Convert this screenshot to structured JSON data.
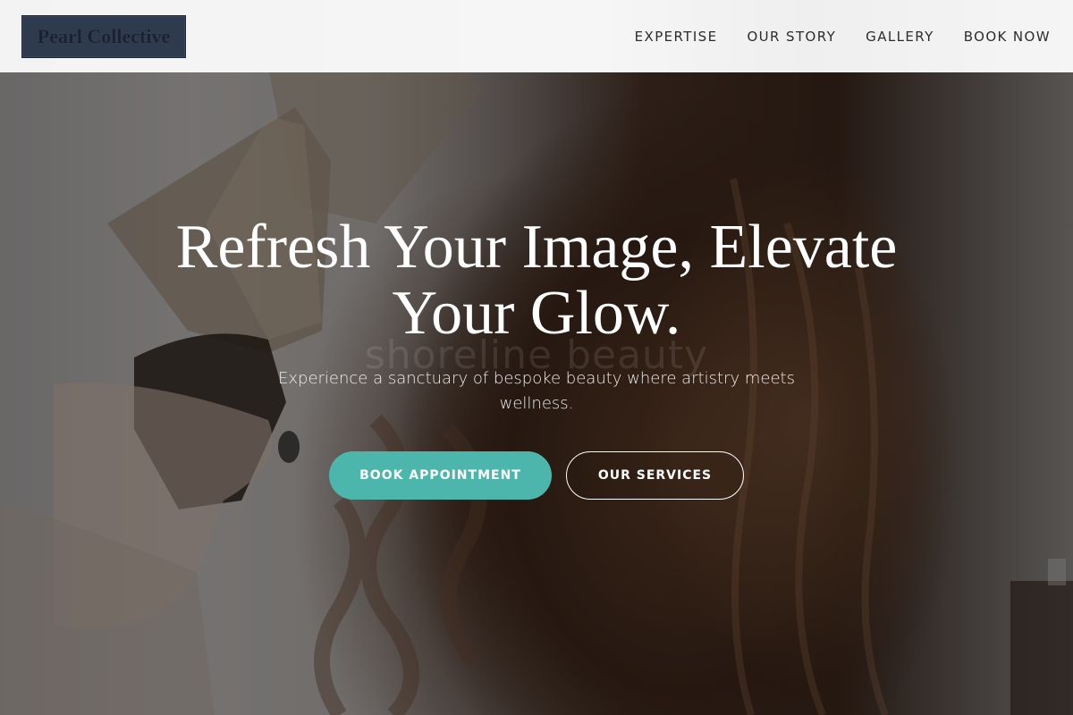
{
  "brand": {
    "logo_text": "Pearl Collective"
  },
  "nav": {
    "items": [
      {
        "label": "EXPERTISE"
      },
      {
        "label": "OUR STORY"
      },
      {
        "label": "GALLERY"
      },
      {
        "label": "BOOK NOW"
      }
    ]
  },
  "hero": {
    "headline": "Refresh Your Image, Elevate Your Glow.",
    "subtext": "Experience a sanctuary of bespoke beauty where artistry meets wellness.",
    "watermark": "shoreline beauty",
    "primary_button": "BOOK APPOINTMENT",
    "secondary_button": "OUR SERVICES",
    "background_image": "hair-curling-photo"
  },
  "colors": {
    "accent": "#4db6ac",
    "logo_bg": "#2e3a4e",
    "header_bg": "#f4f4f4",
    "nav_text": "#2c2c2c"
  }
}
